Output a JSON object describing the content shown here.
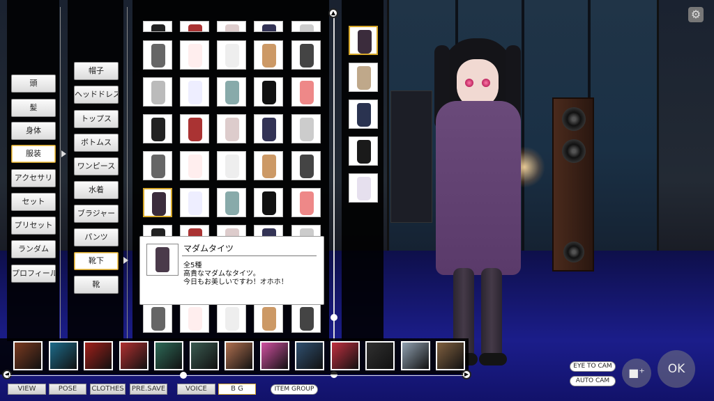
{
  "categories": [
    "頭",
    "髪",
    "身体",
    "服装",
    "アクセサリ",
    "セット",
    "プリセット",
    "ランダム",
    "プロフィール"
  ],
  "categories_selected": 3,
  "subcategories": [
    "帽子",
    "ヘッドドレス",
    "トップス",
    "ボトムス",
    "ワンピース",
    "水着",
    "ブラジャー",
    "パンツ",
    "靴下",
    "靴"
  ],
  "subcategories_selected": 8,
  "tooltip": {
    "title": "マダムタイツ",
    "lines": [
      "全5種",
      "高貴なマダムなタイツ。",
      "今日もお美しいですわ！オホホ！"
    ]
  },
  "variant_colors": [
    "#3b2c3c",
    "#bfa88a",
    "#2a3350",
    "#1a1a1a",
    "#e6e0ee"
  ],
  "bottom_tabs": [
    "VIEW",
    "POSE",
    "CLOTHES",
    "PRE.SAVE",
    "VOICE",
    "B G"
  ],
  "bottom_tabs_selected": 5,
  "item_group_label": "ITEM GROUP",
  "cam_buttons": {
    "eye": "EYE TO CAM",
    "auto": "AUTO CAM"
  },
  "ok_label": "OK",
  "icons": {
    "scroll_up": "triangle-up-icon",
    "prev": "chevron-left-icon",
    "next": "chevron-right-icon",
    "camera": "video-camera-icon",
    "gear": "gear-icon"
  }
}
